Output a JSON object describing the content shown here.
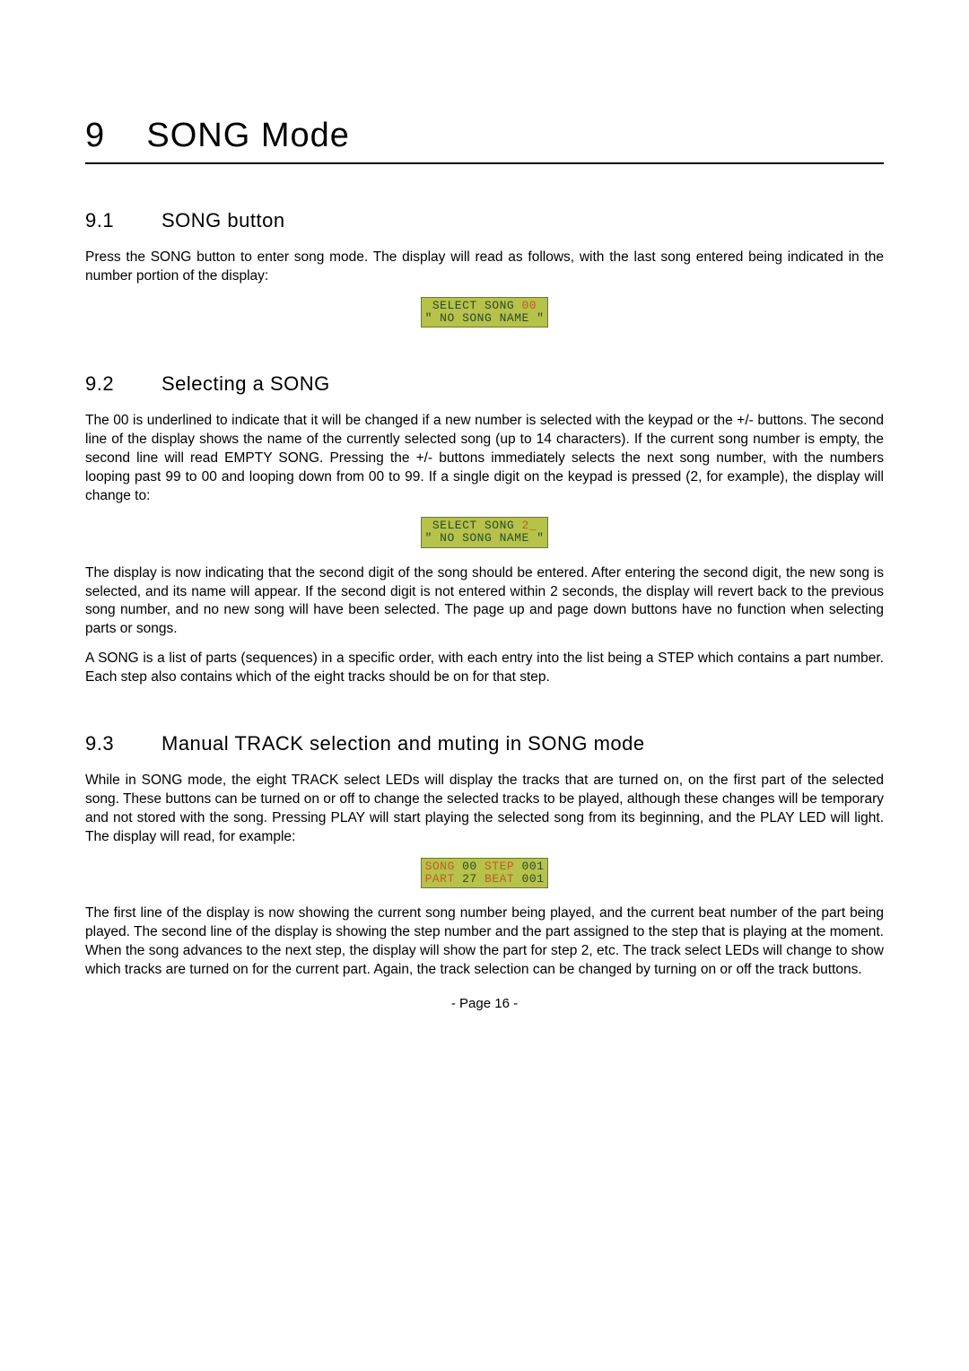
{
  "chapter": {
    "number": "9",
    "title": "SONG Mode"
  },
  "sections": {
    "s1": {
      "num": "9.1",
      "title": "SONG button"
    },
    "s2": {
      "num": "9.2",
      "title": "Selecting a SONG"
    },
    "s3": {
      "num": "9.3",
      "title": "Manual TRACK selection and muting in SONG mode"
    }
  },
  "paragraphs": {
    "p1": "Press the SONG button to enter song mode. The display will read as follows, with the last song entered being indicated in the number portion of the display:",
    "p2": "The 00 is underlined to indicate that it will be changed if a new number is selected with the keypad or the +/- buttons. The second line of the display shows the name of the currently selected song (up to 14 characters). If the current song number is empty, the second line will read EMPTY SONG. Pressing the +/- buttons immediately selects the next song number, with the numbers looping past 99 to 00 and looping down from 00 to 99. If a single digit on the keypad is pressed (2, for example), the display will change to:",
    "p3": "The display is now indicating that the second digit of the song should be entered. After entering the second digit, the new song is selected, and its name will appear. If the second digit is not entered within 2 seconds, the display will revert back to the previous song number, and no new song will have been selected. The page up and page down buttons have no function when selecting parts or songs.",
    "p4": "A SONG is a list of parts (sequences) in a specific order, with each entry into the list being a STEP which contains a part number. Each step also contains which of the eight tracks should be on for that step.",
    "p5": "While in SONG mode, the eight TRACK select LEDs will display the tracks that are turned on, on the first part of the selected song. These buttons can be turned on or off to change the selected tracks to be played, although these changes will be temporary and not stored with the song. Pressing PLAY will start playing the selected song from its beginning, and the PLAY LED will light. The display will read, for example:",
    "p6": "The first line of the display is now showing the current song number being played, and the current beat number of the part being played. The second line of the display is showing the step number and the part assigned to the step that is playing at the moment. When the song advances to the next step, the display will show the part for step 2, etc. The track select LEDs will change to show which tracks are turned on for the current part. Again, the track selection can be changed by turning on or off the track buttons."
  },
  "lcd": {
    "d1": {
      "l1a": " SELECT SONG ",
      "l1b": "00",
      "l2": "\" NO SONG NAME \""
    },
    "d2": {
      "l1a": " SELECT SONG ",
      "l1b": "2_",
      "l2": "\" NO SONG NAME \""
    },
    "d3": {
      "l1a": "SONG ",
      "l1b": "00",
      "l1c": " STEP ",
      "l1d": "001",
      "l2a": "PART ",
      "l2b": "27",
      "l2c": " BEAT ",
      "l2d": "001"
    }
  },
  "footer": "- Page 16 -"
}
